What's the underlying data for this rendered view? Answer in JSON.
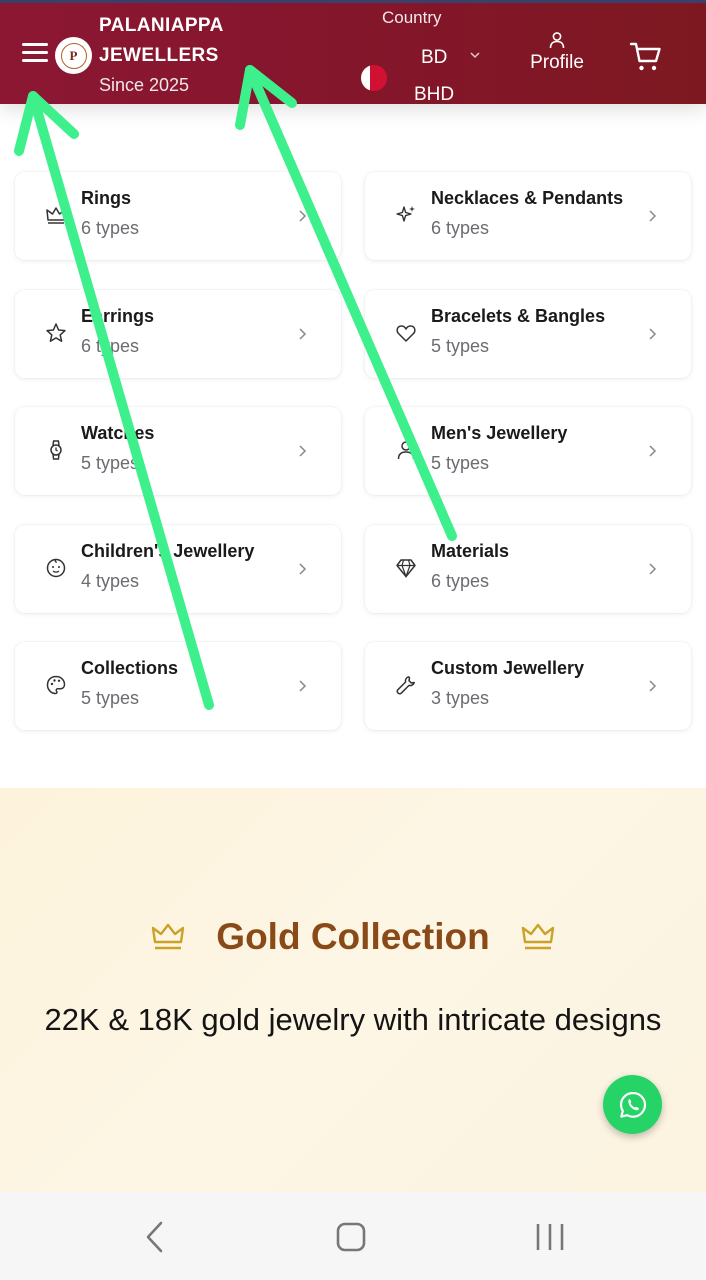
{
  "header": {
    "brand_name_line1": "PALANIAPPA",
    "brand_name_line2": "JEWELLERS",
    "brand_since": "Since 2025",
    "country_label": "Country",
    "country_code": "BD",
    "currency": "BHD",
    "profile_label": "Profile",
    "icons": [
      "hamburger-menu-icon",
      "logo",
      "flag-icon",
      "chevron-down-icon",
      "user-icon",
      "cart-icon"
    ],
    "colors": {
      "header_bg": "#84162b",
      "header_text": "#ffffff"
    }
  },
  "categories": [
    {
      "title": "Rings",
      "subtitle": "6 types",
      "icon": "crown-icon"
    },
    {
      "title": "Necklaces & Pendants",
      "subtitle": "6 types",
      "icon": "sparkles-icon"
    },
    {
      "title": "Earrings",
      "subtitle": "6 types",
      "icon": "star-icon"
    },
    {
      "title": "Bracelets & Bangles",
      "subtitle": "5 types",
      "icon": "heart-icon"
    },
    {
      "title": "Watches",
      "subtitle": "5 types",
      "icon": "watch-icon"
    },
    {
      "title": "Men's Jewellery",
      "subtitle": "5 types",
      "icon": "user-icon"
    },
    {
      "title": "Children's Jewellery",
      "subtitle": "4 types",
      "icon": "baby-icon"
    },
    {
      "title": "Materials",
      "subtitle": "6 types",
      "icon": "gem-icon"
    },
    {
      "title": "Collections",
      "subtitle": "5 types",
      "icon": "palette-icon"
    },
    {
      "title": "Custom Jewellery",
      "subtitle": "3 types",
      "icon": "wrench-icon"
    }
  ],
  "gold_section": {
    "title": "Gold Collection",
    "subtitle": "22K & 18K gold jewelry with intricate designs",
    "colors": {
      "background": "#fdf5e2",
      "title": "#8a4a17",
      "crown": "#c9a227"
    }
  },
  "floating": {
    "whatsapp_color": "#25d366",
    "icon": "whatsapp-icon"
  },
  "annotation": {
    "arrow_color": "#3df08c"
  }
}
